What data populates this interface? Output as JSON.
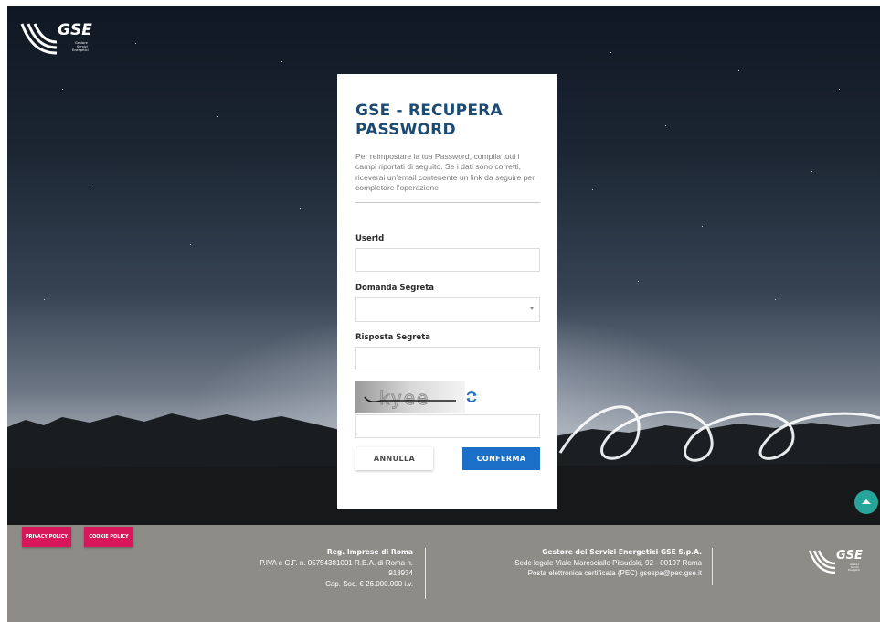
{
  "brand": {
    "logo_text": "GSE",
    "logo_subtext": [
      "Gestore",
      "Servizi",
      "Energetici"
    ]
  },
  "form": {
    "title": "GSE - RECUPERA PASSWORD",
    "description": "Per reimpostare la tua Password, compila tutti i campi riportati di seguito. Se i dati sono corretti, riceverai un'email contenente un link da seguire per completare l'operazione",
    "userid_label": "UserId",
    "userid_value": "",
    "domanda_label": "Domanda Segreta",
    "domanda_value": "",
    "risposta_label": "Risposta Segreta",
    "risposta_value": "",
    "captcha_text": "kyee",
    "captcha_value": "",
    "cancel_label": "ANNULLA",
    "confirm_label": "CONFERMA"
  },
  "footer": {
    "privacy_label": "PRIVACY POLICY",
    "cookie_label": "COOKIE POLICY",
    "reg_title": "Reg. Imprese di Roma",
    "reg_line1": "P.IVA e C.F. n. 05754381001 R.E.A. di Roma n.",
    "reg_line2": "918934",
    "reg_line3": "Cap. Soc. € 26.000.000 i.v.",
    "gestore_title": "Gestore dei Servizi Energetici GSE S.p.A.",
    "gestore_line1": "Sede legale Viale Maresciallo Pilsudski, 92 - 00197 Roma",
    "gestore_line2": "Posta elettronica certificata (PEC) gsespa@pec.gse.it"
  },
  "colors": {
    "title_blue": "#1b4a73",
    "confirm_blue": "#1c6fc6",
    "footer_gray": "#8d8c87",
    "policy_pink": "#d8165a",
    "scroll_teal": "#26a69a"
  },
  "icons": {
    "refresh": "refresh-icon",
    "scroll_top": "chevron-up-icon",
    "select_arrow": "caret-down-icon"
  }
}
